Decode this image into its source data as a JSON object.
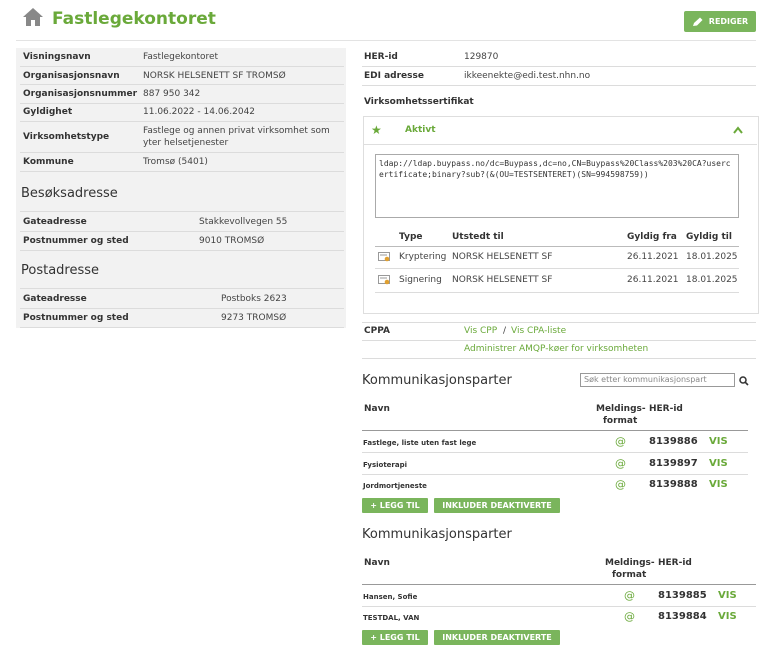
{
  "header": {
    "title": "Fastlegekontoret",
    "edit_label": "REDIGER"
  },
  "left": {
    "info": [
      {
        "label": "Visningsnavn",
        "value": "Fastlegekontoret"
      },
      {
        "label": "Organisasjonsnavn",
        "value": "NORSK HELSENETT SF TROMSØ"
      },
      {
        "label": "Organisasjonsnummer",
        "value": "887 950 342"
      },
      {
        "label": "Gyldighet",
        "value": "11.06.2022 - 14.06.2042"
      },
      {
        "label": "Virksomhetstype",
        "value": "Fastlege og annen privat virksomhet som yter helsetjenester"
      },
      {
        "label": "Kommune",
        "value": "Tromsø (5401)"
      }
    ],
    "besok": {
      "title": "Besøksadresse",
      "rows": [
        {
          "label": "Gateadresse",
          "value": "Stakkevollvegen 55"
        },
        {
          "label": "Postnummer og sted",
          "value": "9010 TROMSØ"
        }
      ]
    },
    "post": {
      "title": "Postadresse",
      "rows": [
        {
          "label": "Gateadresse",
          "value": "Postboks 2623"
        },
        {
          "label": "Postnummer og sted",
          "value": "9273 TROMSØ"
        }
      ]
    }
  },
  "right": {
    "her_label": "HER-id",
    "her_value": "129870",
    "edi_label": "EDI adresse",
    "edi_value": "ikkeenekte@edi.test.nhn.no",
    "cert_title": "Virksomhetssertifikat",
    "cert_status": "Aktivt",
    "ldap": "ldap://ldap.buypass.no/dc=Buypass,dc=no,CN=Buypass%20Class%203%20CA?usercertificate;binary?sub?(&(OU=TESTSENTERET)(SN=994598759))",
    "cert_headers": {
      "type": "Type",
      "issuer": "Utstedt til",
      "from": "Gyldig fra",
      "to": "Gyldig til"
    },
    "certs": [
      {
        "type": "Kryptering",
        "issuer": "NORSK HELSENETT SF",
        "from": "26.11.2021",
        "to": "18.01.2025"
      },
      {
        "type": "Signering",
        "issuer": "NORSK HELSENETT SF",
        "from": "26.11.2021",
        "to": "18.01.2025"
      }
    ],
    "cppa_label": "CPPA",
    "vis_cpp": "Vis CPP",
    "sep": "/",
    "vis_cpa": "Vis CPA-liste",
    "amqp": "Administrer AMQP-køer for virksomheten"
  },
  "komm1": {
    "title": "Kommunikasjonsparter",
    "search_placeholder": "Søk etter kommunikasjonspart",
    "col_name": "Navn",
    "col_format_1": "Meldings-",
    "col_format_2": "format",
    "col_her": "HER-id",
    "rows": [
      {
        "name": "Fastlege, liste uten fast lege",
        "format": "@",
        "her": "8139886",
        "vis": "VIS"
      },
      {
        "name": "Fysioterapi",
        "format": "@",
        "her": "8139897",
        "vis": "VIS"
      },
      {
        "name": "Jordmortjeneste",
        "format": "@",
        "her": "8139888",
        "vis": "VIS"
      }
    ],
    "add_label": "+ LEGG TIL",
    "include_label": "INKLUDER DEAKTIVERTE"
  },
  "komm2": {
    "title": "Kommunikasjonsparter",
    "col_name": "Navn",
    "col_format_1": "Meldings-",
    "col_format_2": "format",
    "col_her": "HER-id",
    "rows": [
      {
        "name": "Hansen, Sofie",
        "format": "@",
        "her": "8139885",
        "vis": "VIS"
      },
      {
        "name": "TESTDAL, VAN",
        "format": "@",
        "her": "8139884",
        "vis": "VIS"
      }
    ],
    "add_label": "+ LEGG TIL",
    "include_label": "INKLUDER DEAKTIVERTE"
  },
  "colors": {
    "accent": "#6aa93a",
    "button": "#7ab55c"
  },
  "icons": [
    "home-icon",
    "pencil-icon",
    "star-icon",
    "chevron-up-icon",
    "certificate-icon",
    "search-icon"
  ]
}
